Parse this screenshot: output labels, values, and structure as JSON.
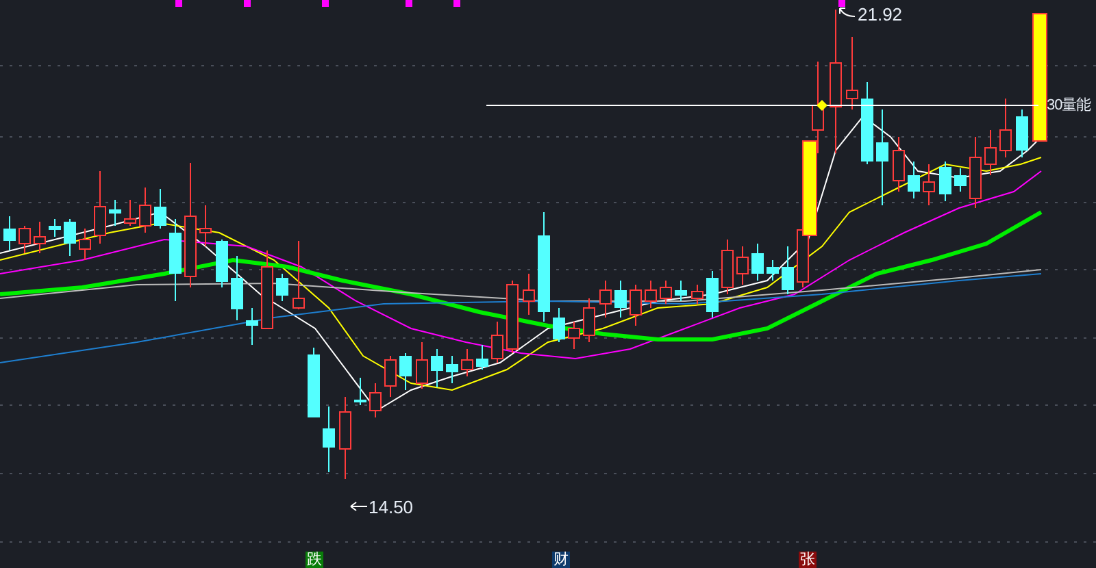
{
  "chart": {
    "high_label": "21.92",
    "low_label": "14.50",
    "line_label": "30量能"
  },
  "markers": [
    {
      "text": "跌",
      "color": "#0a7d0a"
    },
    {
      "text": "财",
      "color": "#0d3a6b"
    },
    {
      "text": "张",
      "color": "#8a0c0c"
    }
  ]
}
